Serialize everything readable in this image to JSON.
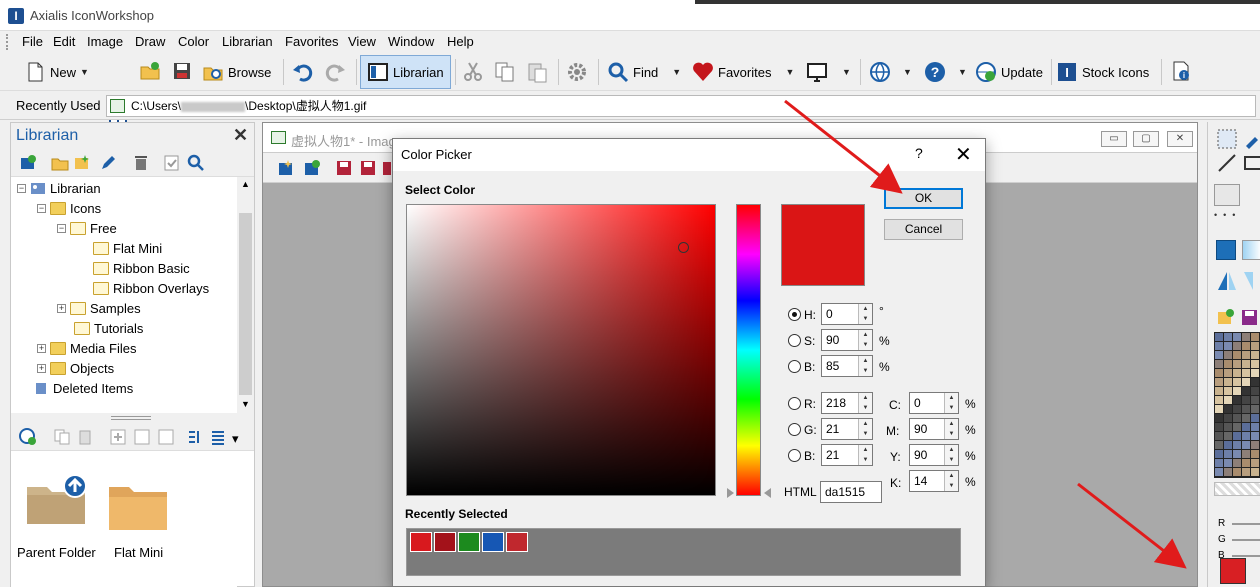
{
  "app": {
    "title": "Axialis IconWorkshop",
    "icon_letter": "I"
  },
  "menu": [
    "File",
    "Edit",
    "Image",
    "Draw",
    "Color",
    "Librarian",
    "Favorites",
    "View",
    "Window",
    "Help"
  ],
  "toolbar": {
    "new": "New",
    "browse": "Browse",
    "librarian": "Librarian",
    "find": "Find",
    "favorites": "Favorites",
    "update": "Update",
    "stock_icons": "Stock Icons"
  },
  "recent": {
    "label": "Recently Used",
    "path_prefix": "C:\\Users\\",
    "path_suffix": "\\Desktop\\虚拟人物1.gif"
  },
  "librarian": {
    "title": "Librarian",
    "tree": [
      {
        "label": "Librarian"
      },
      {
        "label": "Icons"
      },
      {
        "label": "Free"
      },
      {
        "label": "Flat Mini"
      },
      {
        "label": "Ribbon Basic"
      },
      {
        "label": "Ribbon Overlays"
      },
      {
        "label": "Samples"
      },
      {
        "label": "Tutorials"
      },
      {
        "label": "Media Files"
      },
      {
        "label": "Objects"
      },
      {
        "label": "Deleted Items"
      }
    ],
    "view_items": [
      "Parent Folder",
      "Flat Mini"
    ]
  },
  "document": {
    "title": "虚拟人物1* - Imag"
  },
  "color_picker": {
    "title": "Color Picker",
    "help": "?",
    "close": "✕",
    "select_color_label": "Select Color",
    "ok": "OK",
    "cancel": "Cancel",
    "current_color": "#da1515",
    "hsb": {
      "h": "0",
      "s": "90",
      "b": "85"
    },
    "hsb_labels": {
      "h": "H:",
      "s": "S:",
      "b": "B:"
    },
    "hsb_units": {
      "h": "°",
      "s": "%",
      "b": "%"
    },
    "rgb": {
      "r": "218",
      "g": "21",
      "b": "21"
    },
    "rgb_labels": {
      "r": "R:",
      "g": "G:",
      "b": "B:"
    },
    "cmyk": {
      "c": "0",
      "m": "90",
      "y": "90",
      "k": "14"
    },
    "cmyk_labels": {
      "c": "C:",
      "m": "M:",
      "y": "Y:",
      "k": "K:"
    },
    "pct": "%",
    "html_label": "HTML",
    "html_value": "da1515",
    "recently_selected_label": "Recently Selected",
    "recent_colors": [
      "#d8191e",
      "#a3121a",
      "#1c8a1e",
      "#1657b4",
      "#c0282e"
    ]
  },
  "right_panel": {
    "r": "R",
    "g": "G",
    "b": "B"
  },
  "colors": {
    "accent": "#0078d7",
    "dialog_bg": "#f0f0f0",
    "annotation_arrow": "#e01b1b"
  }
}
